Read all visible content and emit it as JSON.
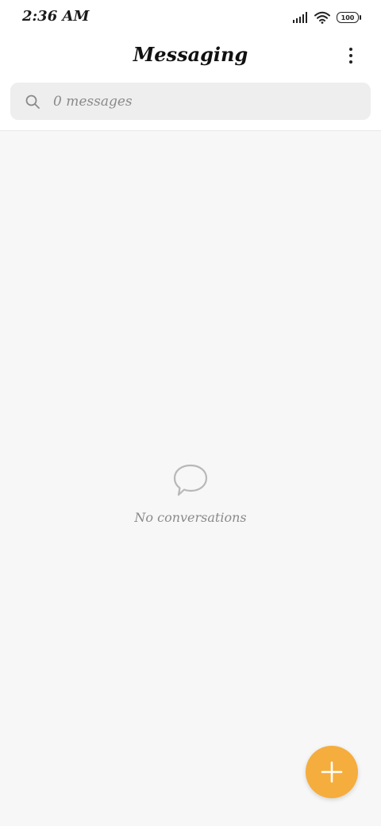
{
  "status_bar": {
    "time": "2:36 AM",
    "battery_level": "100",
    "icons": [
      "signal-icon",
      "wifi-icon",
      "battery-icon"
    ]
  },
  "header": {
    "title": "Messaging",
    "more_icon": "more-vertical-icon"
  },
  "search": {
    "placeholder": "0 messages",
    "icon": "search-icon"
  },
  "empty_state": {
    "icon": "chat-bubble-icon",
    "text": "No conversations"
  },
  "fab": {
    "icon": "plus-icon",
    "color": "#f5ad3d"
  },
  "colors": {
    "background": "#f7f7f7",
    "header_background": "#ffffff",
    "search_background": "#eeeeee",
    "accent": "#f5ad3d"
  }
}
